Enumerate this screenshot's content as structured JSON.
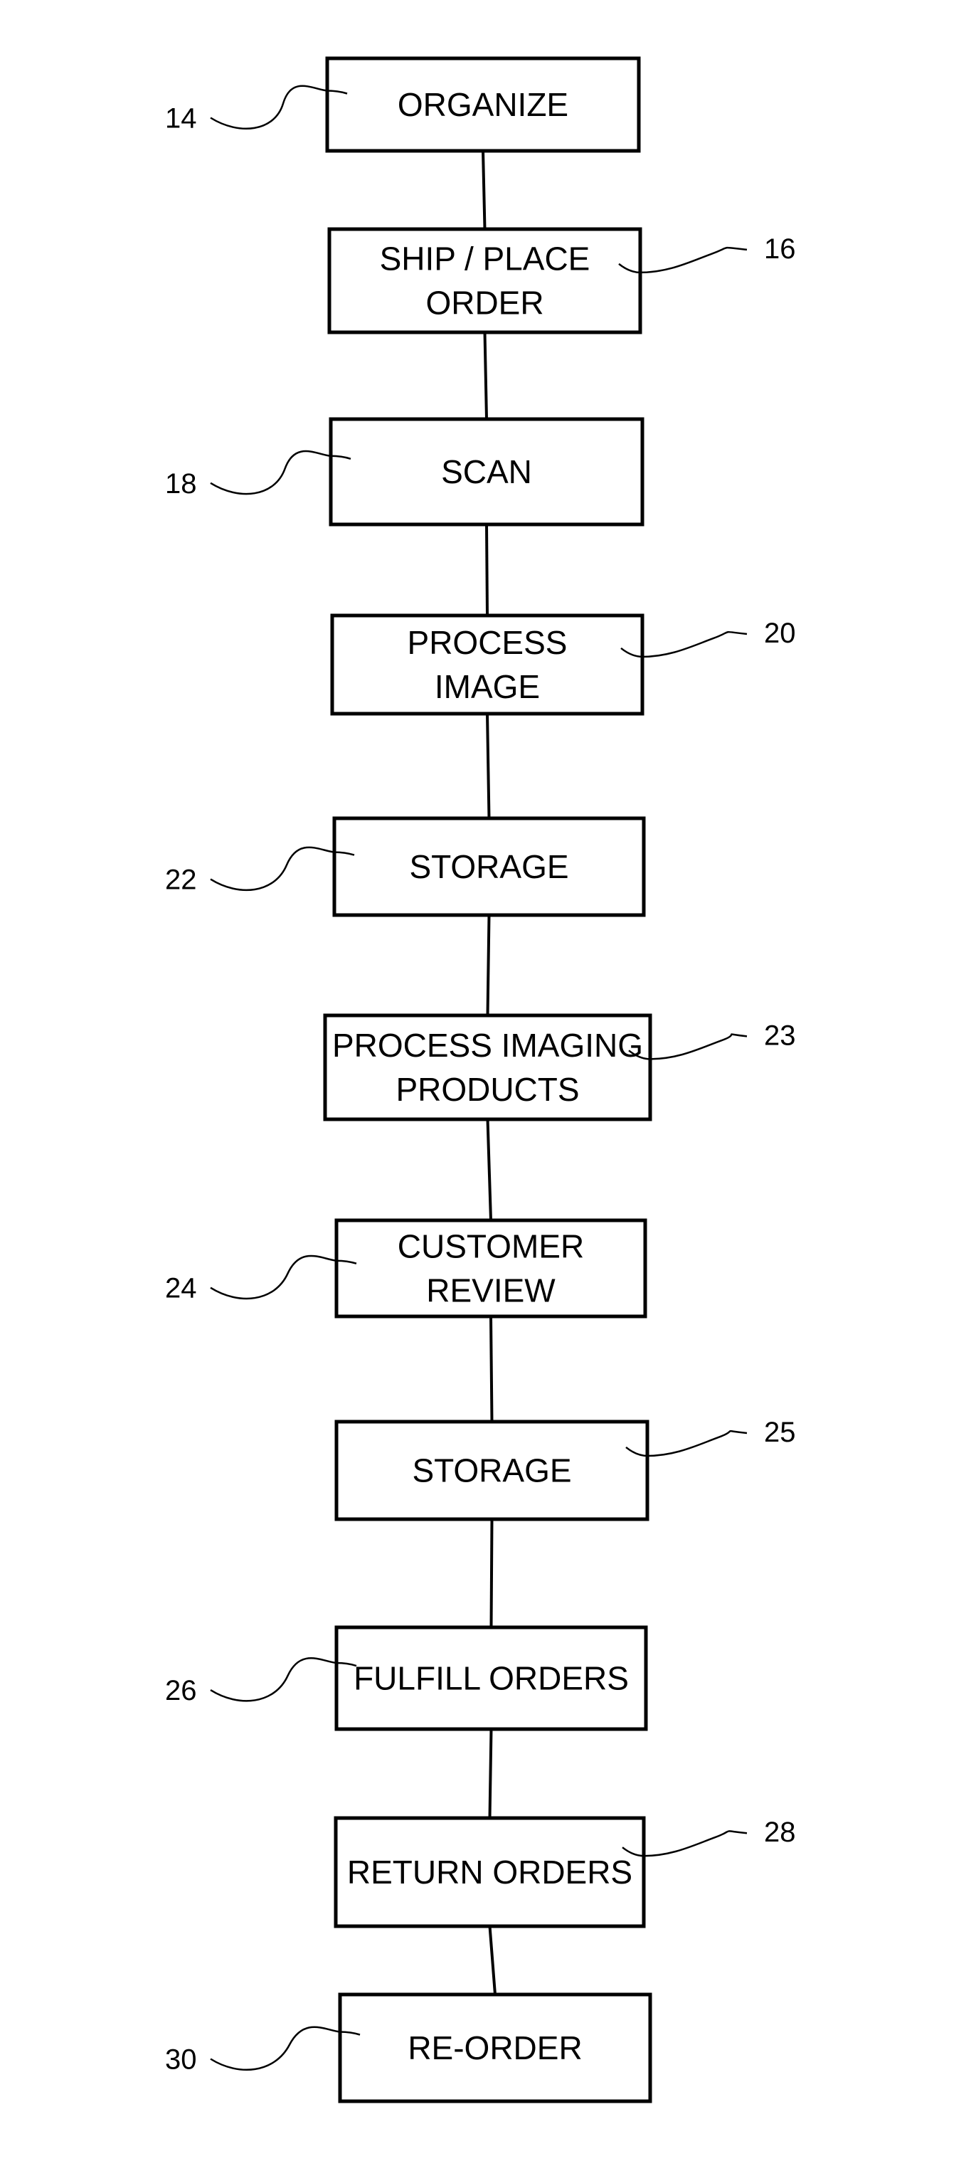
{
  "diagram": {
    "type": "flowchart",
    "direction": "top-to-bottom",
    "colors": {
      "stroke": "#000000",
      "background": "#ffffff"
    },
    "steps": [
      {
        "ref": "14",
        "lines": [
          "ORGANIZE"
        ],
        "label_side": "left"
      },
      {
        "ref": "16",
        "lines": [
          "SHIP / PLACE",
          "ORDER"
        ],
        "label_side": "right"
      },
      {
        "ref": "18",
        "lines": [
          "SCAN"
        ],
        "label_side": "left"
      },
      {
        "ref": "20",
        "lines": [
          "PROCESS",
          "IMAGE"
        ],
        "label_side": "right"
      },
      {
        "ref": "22",
        "lines": [
          "STORAGE"
        ],
        "label_side": "left"
      },
      {
        "ref": "23",
        "lines": [
          "PROCESS IMAGING",
          "PRODUCTS"
        ],
        "label_side": "right"
      },
      {
        "ref": "24",
        "lines": [
          "CUSTOMER",
          "REVIEW"
        ],
        "label_side": "left"
      },
      {
        "ref": "25",
        "lines": [
          "STORAGE"
        ],
        "label_side": "right"
      },
      {
        "ref": "26",
        "lines": [
          "FULFILL ORDERS"
        ],
        "label_side": "left"
      },
      {
        "ref": "28",
        "lines": [
          "RETURN ORDERS"
        ],
        "label_side": "right"
      },
      {
        "ref": "30",
        "lines": [
          "RE-ORDER"
        ],
        "label_side": "left"
      }
    ],
    "edges": [
      [
        "14",
        "16"
      ],
      [
        "16",
        "18"
      ],
      [
        "18",
        "20"
      ],
      [
        "20",
        "22"
      ],
      [
        "22",
        "23"
      ],
      [
        "23",
        "24"
      ],
      [
        "24",
        "25"
      ],
      [
        "25",
        "26"
      ],
      [
        "26",
        "28"
      ],
      [
        "28",
        "30"
      ]
    ]
  }
}
